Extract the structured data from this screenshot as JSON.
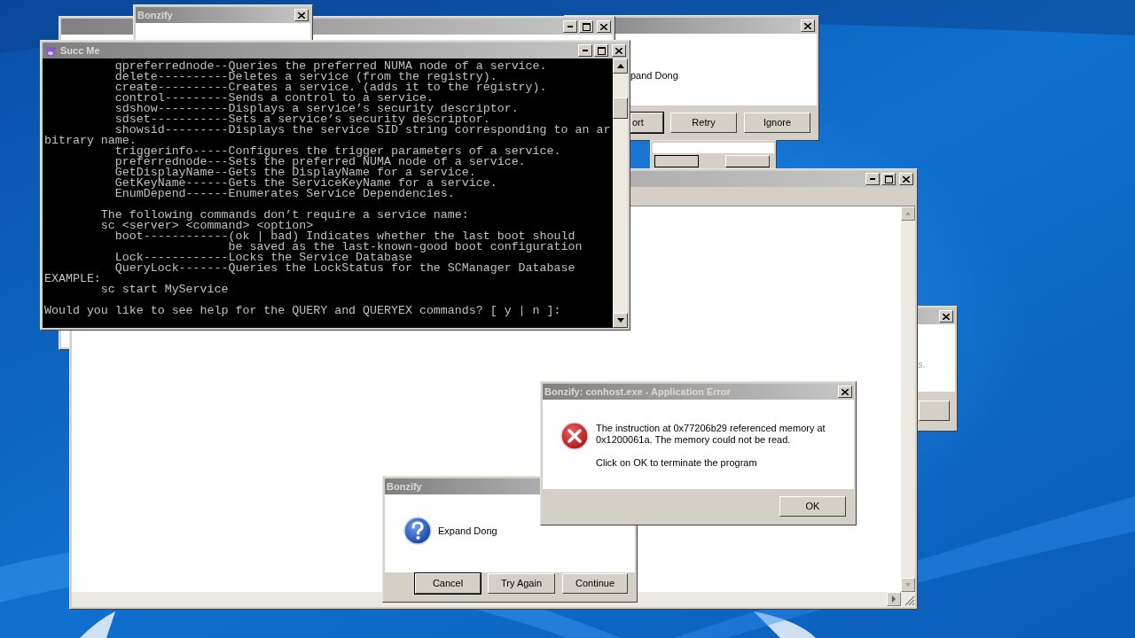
{
  "back_window": {
    "title": "Bonzify"
  },
  "abort_dialog": {
    "message": "pand Dong",
    "buttons": [
      {
        "label": "ort",
        "default": true
      },
      {
        "label": "Retry",
        "default": false
      },
      {
        "label": "Ignore",
        "default": false
      }
    ]
  },
  "console_window": {
    "title": "Succ Me",
    "blocks": [
      [
        "          qpreferrednode--Queries the preferred NUMA node of a service.",
        "          delete----------Deletes a service (from the registry).",
        "          create----------Creates a service. (adds it to the registry).",
        "          control---------Sends a control to a service.",
        "          sdshow----------Displays a service’s security descriptor.",
        "          sdset-----------Sets a service’s security descriptor.",
        "          showsid---------Displays the service SID string corresponding to an ar",
        "bitrary name.",
        "          triggerinfo-----Configures the trigger parameters of a service.",
        "          preferrednode---Sets the preferred NUMA node of a service.",
        "          GetDisplayName--Gets the DisplayName for a service.",
        "          GetKeyName------Gets the ServiceKeyName for a service.",
        "          EnumDepend------Enumerates Service Dependencies."
      ],
      [
        "        The following commands don’t require a service name:",
        "        sc <server> <command> <option>",
        "          boot------------(ok | bad) Indicates whether the last boot should",
        "                          be saved as the last-known-good boot configuration",
        "          Lock------------Locks the Service Database",
        "          QueryLock-------Queries the LockStatus for the SCManager Database",
        "EXAMPLE:",
        "        sc start MyService"
      ],
      [
        "Would you like to see help for the QUERY and QUERYEX commands? [ y | n ]:"
      ]
    ]
  },
  "right_dialog": {
    "message": "s."
  },
  "question_dialog": {
    "title": "Bonzify",
    "message": "Expand Dong",
    "buttons": [
      {
        "label": "Cancel",
        "default": true
      },
      {
        "label": "Try Again",
        "default": false
      },
      {
        "label": "Continue",
        "default": false
      }
    ]
  },
  "error_dialog": {
    "title": "Bonzify: conhost.exe - Application Error",
    "message_lines": [
      "The instruction at 0x77206b29 referenced memory at",
      "0x1200061a. The memory could not be read."
    ],
    "note": "Click on OK to terminate the program",
    "buttons": [
      {
        "label": "OK",
        "default": false
      }
    ]
  }
}
